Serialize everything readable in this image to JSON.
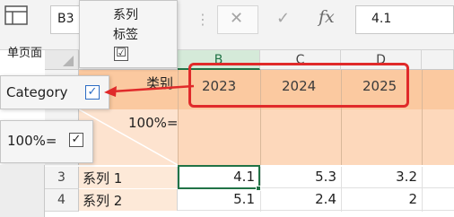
{
  "toolbar": {
    "page_layout_label": "单页面",
    "name_box": "B3",
    "cancel_icon": "close-icon",
    "enter_icon": "check-icon",
    "fx_label": "fx",
    "formula_value": "4.1"
  },
  "series_label_panel": {
    "title_line1": "系列",
    "title_line2": "标签",
    "checked": "☑"
  },
  "category_panel": {
    "label": "Category",
    "checked": "✓"
  },
  "percent_panel": {
    "label": "100%=",
    "checked": "✓"
  },
  "columns": [
    "B",
    "C",
    "D"
  ],
  "header": {
    "category_cell": "类别",
    "percent_cell": "100%=",
    "series_fragment": "列",
    "years": [
      "2023",
      "2024",
      "2025"
    ]
  },
  "rows": [
    {
      "row_num": "3",
      "label": "系列 1",
      "values": [
        "4.1",
        "5.3",
        "3.2"
      ]
    },
    {
      "row_num": "4",
      "label": "系列 2",
      "values": [
        "5.1",
        "2.4",
        "2"
      ]
    }
  ],
  "colors": {
    "highlight": "#e02a2a",
    "accent_green": "#217346",
    "header_band": "#fbc9a0"
  }
}
